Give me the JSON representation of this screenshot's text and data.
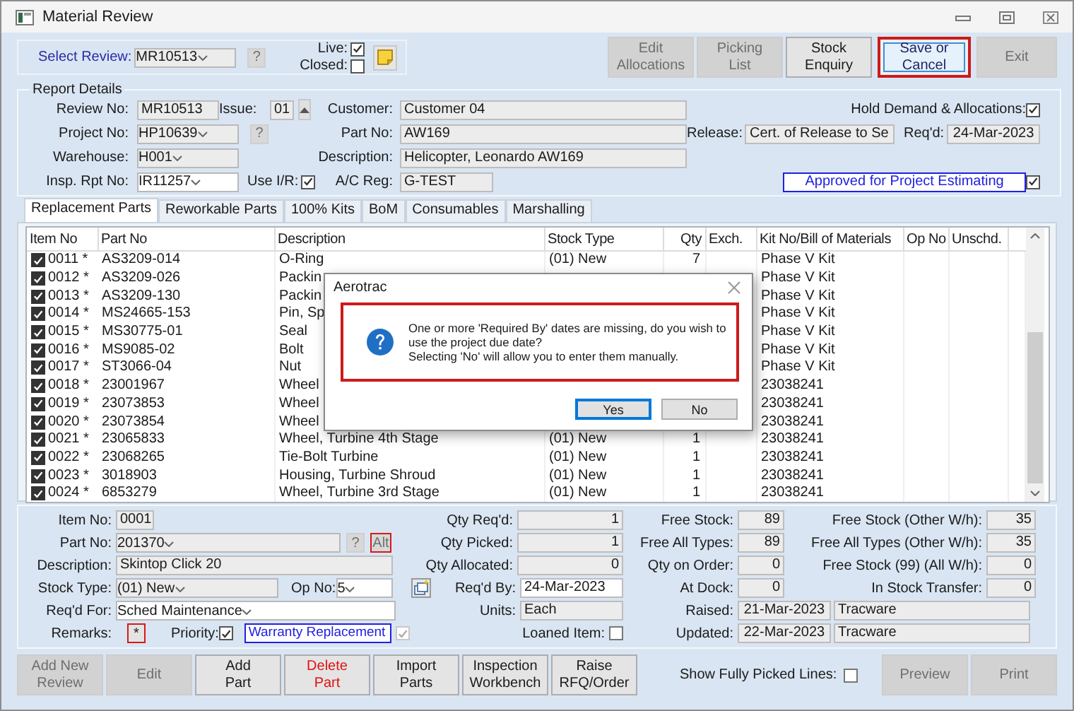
{
  "window": {
    "title": "Material Review"
  },
  "header": {
    "select_label": "Select Review:",
    "review": "MR10513",
    "help": {
      "label": "?",
      "disabled": true
    },
    "live": {
      "label": "Live:",
      "checked": true
    },
    "closed": {
      "label": "Closed:",
      "checked": false
    }
  },
  "toolbar": [
    {
      "label": "Edit\nAllocations",
      "disabled": true,
      "highlighted": false
    },
    {
      "label": "Picking\nList",
      "disabled": true,
      "highlighted": false
    },
    {
      "label": "Stock\nEnquiry",
      "disabled": false,
      "highlighted": false
    },
    {
      "label": "Save or\nCancel",
      "disabled": false,
      "highlighted": true
    },
    {
      "label": "Exit",
      "disabled": true,
      "highlighted": false
    }
  ],
  "report": {
    "title": "Report Details",
    "review_no": {
      "label": "Review No:",
      "value": "MR10513"
    },
    "issue": {
      "label": "Issue:",
      "value": "01"
    },
    "project_no": {
      "label": "Project No:",
      "value": "HP10639",
      "help": "?"
    },
    "warehouse": {
      "label": "Warehouse:",
      "value": "H001"
    },
    "insp_rpt_no": {
      "label": "Insp. Rpt No:",
      "value": "IR11257"
    },
    "use_ir": {
      "label": "Use I/R:",
      "checked": true
    },
    "customer": {
      "label": "Customer:",
      "value": "Customer 04"
    },
    "part_no": {
      "label": "Part No:",
      "value": "AW169"
    },
    "description": {
      "label": "Description:",
      "value": "Helicopter, Leonardo AW169"
    },
    "ac_reg": {
      "label": "A/C Reg:",
      "value": "G-TEST"
    },
    "hold": {
      "label": "Hold Demand & Allocations:",
      "checked": true
    },
    "release": {
      "label": "Release:",
      "value": "Cert. of Release to Se"
    },
    "reqd": {
      "label": "Req'd:",
      "value": "24-Mar-2023"
    },
    "status": {
      "value": "Approved for Project Estimating",
      "checked": true
    }
  },
  "tabs": [
    {
      "label": "Replacement Parts",
      "selected": true
    },
    {
      "label": "Reworkable Parts",
      "selected": false
    },
    {
      "label": "100% Kits",
      "selected": false
    },
    {
      "label": "BoM",
      "selected": false
    },
    {
      "label": "Consumables",
      "selected": false
    },
    {
      "label": "Marshalling",
      "selected": false
    }
  ],
  "table": {
    "columns": [
      "Item No",
      "Part No",
      "Description",
      "Stock Type",
      "Qty",
      "Exch.",
      "Kit No/Bill of Materials",
      "Op No",
      "Unschd."
    ],
    "rows": [
      {
        "checked": true,
        "item": "0011 *",
        "part": "AS3209-014",
        "desc": "O-Ring",
        "stock_type": "(01) New",
        "qty": "7",
        "kit": "Phase V Kit"
      },
      {
        "checked": true,
        "item": "0012 *",
        "part": "AS3209-026",
        "desc": "Packin",
        "kit": "Phase V Kit"
      },
      {
        "checked": true,
        "item": "0013 *",
        "part": "AS3209-130",
        "desc": "Packin",
        "kit": "Phase V Kit"
      },
      {
        "checked": true,
        "item": "0014 *",
        "part": "MS24665-153",
        "desc": "Pin, Sp",
        "kit": "Phase V Kit"
      },
      {
        "checked": true,
        "item": "0015 *",
        "part": "MS30775-01",
        "desc": "Seal",
        "kit": "Phase V Kit"
      },
      {
        "checked": true,
        "item": "0016 *",
        "part": "MS9085-02",
        "desc": "Bolt",
        "kit": "Phase V Kit"
      },
      {
        "checked": true,
        "item": "0017 *",
        "part": "ST3066-04",
        "desc": "Nut",
        "kit": "Phase V Kit"
      },
      {
        "checked": true,
        "item": "0018 *",
        "part": "23001967",
        "desc": "Wheel",
        "kit": "23038241"
      },
      {
        "checked": true,
        "item": "0019 *",
        "part": "23073853",
        "desc": "Wheel",
        "kit": "23038241"
      },
      {
        "checked": true,
        "item": "0020 *",
        "part": "23073854",
        "desc": "Wheel",
        "kit": "23038241"
      },
      {
        "checked": true,
        "item": "0021 *",
        "part": "23065833",
        "desc": "Wheel, Turbine 4th Stage",
        "stock_type": "(01) New",
        "qty": "1",
        "kit": "23038241"
      },
      {
        "checked": true,
        "item": "0022 *",
        "part": "23068265",
        "desc": "Tie-Bolt Turbine",
        "stock_type": "(01) New",
        "qty": "1",
        "kit": "23038241"
      },
      {
        "checked": true,
        "item": "0023 *",
        "part": "3018903",
        "desc": "Housing, Turbine Shroud",
        "stock_type": "(01) New",
        "qty": "1",
        "kit": "23038241"
      },
      {
        "checked": true,
        "item": "0024 *",
        "part": "6853279",
        "desc": "Wheel, Turbine 3rd Stage",
        "stock_type": "(01) New",
        "qty": "1",
        "kit": "23038241"
      }
    ]
  },
  "detail": {
    "item_no": {
      "label": "Item No:",
      "value": "0001"
    },
    "part_no": {
      "label": "Part No:",
      "value": "201370",
      "help": "?",
      "alt": "Alt",
      "alt_highlighted": true
    },
    "description": {
      "label": "Description:",
      "value": "Skintop Click 20"
    },
    "stock_type": {
      "label": "Stock Type:",
      "value": "(01) New"
    },
    "op_no": {
      "label": "Op No:",
      "value": "5"
    },
    "reqd_for": {
      "label": "Req'd For:",
      "value": "Sched Maintenance"
    },
    "remarks": {
      "label": "Remarks:",
      "value": "*",
      "highlighted": true
    },
    "priority": {
      "label": "Priority:",
      "checked": true,
      "value": "Warranty Replacement",
      "value_checked": true
    },
    "middle": [
      {
        "label": "Qty Req'd:",
        "value": "1",
        "kind": "number"
      },
      {
        "label": "Qty Picked:",
        "value": "1",
        "kind": "number"
      },
      {
        "label": "Qty Allocated:",
        "value": "0",
        "kind": "number"
      },
      {
        "label": "Req'd By:",
        "value": "24-Mar-2023",
        "kind": "date"
      },
      {
        "label": "Units:",
        "value": "Each",
        "kind": "text"
      },
      {
        "label": "Loaned Item:",
        "checked": false,
        "kind": "check"
      }
    ],
    "stock": [
      {
        "label": "Free Stock:",
        "value": "89"
      },
      {
        "label": "Free All Types:",
        "value": "89"
      },
      {
        "label": "Qty on Order:",
        "value": "0"
      },
      {
        "label": "At Dock:",
        "value": "0"
      }
    ],
    "other_stock": [
      {
        "label": "Free Stock (Other W/h):",
        "value": "35"
      },
      {
        "label": "Free All Types (Other W/h):",
        "value": "35"
      },
      {
        "label": "Free Stock (99) (All W/h):",
        "value": "0"
      },
      {
        "label": "In Stock Transfer:",
        "value": "0"
      }
    ],
    "audit": [
      {
        "label": "Raised:",
        "date": "21-Mar-2023",
        "user": "Tracware"
      },
      {
        "label": "Updated:",
        "date": "22-Mar-2023",
        "user": "Tracware"
      }
    ]
  },
  "actions": [
    {
      "label": "Add New\nReview",
      "disabled": true,
      "kind": "normal"
    },
    {
      "label": "Edit",
      "disabled": true,
      "kind": "normal"
    },
    {
      "label": "Add\nPart",
      "disabled": false,
      "kind": "normal"
    },
    {
      "label": "Delete\nPart",
      "disabled": false,
      "kind": "danger"
    },
    {
      "label": "Import\nParts",
      "disabled": false,
      "kind": "normal"
    },
    {
      "label": "Inspection\nWorkbench",
      "disabled": false,
      "kind": "normal"
    },
    {
      "label": "Raise\nRFQ/Order",
      "disabled": false,
      "kind": "normal"
    }
  ],
  "show_fully_picked": {
    "label": "Show Fully Picked Lines:",
    "checked": false
  },
  "output_buttons": [
    {
      "label": "Preview",
      "disabled": true
    },
    {
      "label": "Print",
      "disabled": true
    }
  ],
  "dialog": {
    "title": "Aerotrac",
    "message": "One or more 'Required By' dates are missing, do you wish to\nuse the project due date?\nSelecting 'No' will allow you to enter them manually.",
    "highlighted": true,
    "buttons": [
      {
        "label": "Yes",
        "selected": true
      },
      {
        "label": "No",
        "selected": false
      }
    ]
  }
}
